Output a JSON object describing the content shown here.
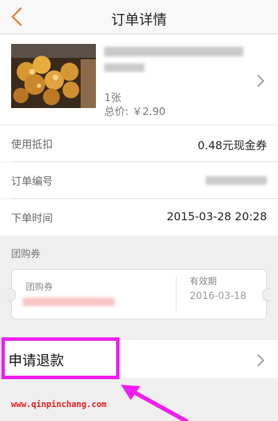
{
  "header": {
    "title": "订单详情",
    "back_icon": "chevron-left-icon",
    "accent": "#ef7a2b"
  },
  "product": {
    "quantity": "1张",
    "price": "总价: ￥2.90",
    "chevron_icon": "chevron-right-icon"
  },
  "rows": [
    {
      "label": "使用抵扣",
      "value": "0.48元现金券"
    },
    {
      "label": "订单编号",
      "value": ""
    },
    {
      "label": "下单时间",
      "value": "2015-03-28 20:28"
    }
  ],
  "coupon": {
    "section_title": "团购券",
    "label": "团购券",
    "expiry_label": "有效期",
    "expiry_value": "2016-03-18"
  },
  "refund": {
    "label": "申请退款",
    "chevron_icon": "chevron-right-icon"
  },
  "watermark": {
    "text": "www.qinpinchang.com",
    "color": "#e61e1e"
  },
  "annotation": {
    "highlight_color": "#f21df2"
  }
}
